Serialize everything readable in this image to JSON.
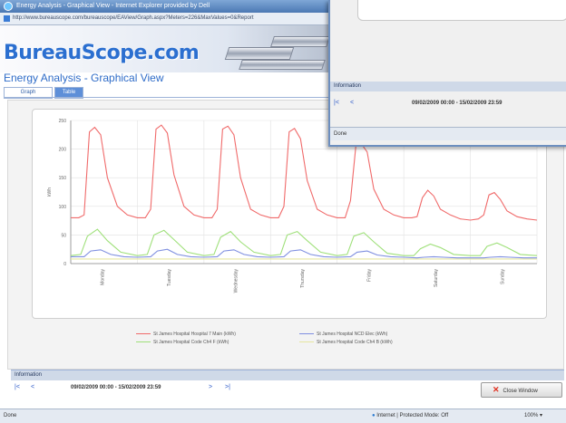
{
  "window": {
    "title": "Energy Analysis - Graphical View - Internet Explorer provided by Dell",
    "url": "http://www.bureauscope.com/bureauscope/EAView/Graph.aspx?Meters=226&MaxValues=0&Report"
  },
  "brand": {
    "logo": "BureauScope.com"
  },
  "page": {
    "title": "Energy Analysis - Graphical View",
    "tabs": [
      {
        "label": "Graph"
      },
      {
        "label": "Table"
      }
    ]
  },
  "chart_data": {
    "type": "line",
    "ylabel": "kWh",
    "ylim": [
      0,
      250
    ],
    "yticks": [
      0,
      50,
      100,
      150,
      200,
      250
    ],
    "x_range": [
      0,
      7
    ],
    "categories": [
      "Monday",
      "Tuesday",
      "Wednesday",
      "Thursday",
      "Friday",
      "Saturday",
      "Sunday"
    ],
    "series": [
      {
        "name": "St James Hospital Hospital 7 Main (kWh)",
        "color": "#f06a6a",
        "x": [
          0,
          0.12,
          0.2,
          0.28,
          0.36,
          0.45,
          0.55,
          0.7,
          0.85,
          1.0,
          1.12,
          1.2,
          1.28,
          1.36,
          1.45,
          1.55,
          1.7,
          1.85,
          2.0,
          2.12,
          2.2,
          2.28,
          2.36,
          2.45,
          2.55,
          2.7,
          2.85,
          3.0,
          3.12,
          3.2,
          3.28,
          3.36,
          3.45,
          3.55,
          3.7,
          3.85,
          4.0,
          4.12,
          4.2,
          4.28,
          4.36,
          4.45,
          4.55,
          4.7,
          4.85,
          5.0,
          5.12,
          5.2,
          5.28,
          5.36,
          5.45,
          5.55,
          5.7,
          5.85,
          6.0,
          6.12,
          6.2,
          6.28,
          6.36,
          6.45,
          6.55,
          6.7,
          6.85,
          7.0
        ],
        "values": [
          80,
          80,
          85,
          230,
          238,
          225,
          150,
          100,
          85,
          80,
          80,
          95,
          235,
          242,
          228,
          155,
          100,
          85,
          80,
          80,
          95,
          235,
          240,
          225,
          150,
          95,
          85,
          80,
          80,
          100,
          230,
          236,
          218,
          145,
          95,
          85,
          80,
          80,
          110,
          205,
          210,
          195,
          130,
          95,
          85,
          80,
          80,
          82,
          115,
          128,
          118,
          95,
          85,
          78,
          76,
          78,
          85,
          120,
          124,
          112,
          92,
          82,
          78,
          76
        ]
      },
      {
        "name": "St James Hospital NCD Elec (kWh)",
        "color": "#7f8fe0",
        "x": [
          0,
          0.2,
          0.3,
          0.45,
          0.6,
          0.8,
          1.0,
          1.2,
          1.3,
          1.45,
          1.6,
          1.8,
          2.0,
          2.2,
          2.3,
          2.45,
          2.6,
          2.8,
          3.0,
          3.2,
          3.3,
          3.45,
          3.6,
          3.8,
          4.0,
          4.2,
          4.3,
          4.45,
          4.6,
          4.8,
          5.0,
          5.2,
          5.3,
          5.45,
          5.6,
          5.8,
          6.0,
          6.2,
          6.3,
          6.45,
          6.6,
          6.8,
          7.0
        ],
        "values": [
          12,
          12,
          22,
          24,
          16,
          12,
          11,
          12,
          22,
          25,
          16,
          12,
          11,
          12,
          22,
          24,
          16,
          12,
          11,
          12,
          22,
          24,
          16,
          12,
          11,
          12,
          20,
          22,
          15,
          12,
          11,
          10,
          11,
          12,
          11,
          10,
          10,
          10,
          11,
          12,
          11,
          10,
          10
        ]
      },
      {
        "name": "St James Hospital Code Ch4 F (kWh)",
        "color": "#9fe07a",
        "x": [
          0,
          0.15,
          0.25,
          0.4,
          0.55,
          0.75,
          1.0,
          1.15,
          1.25,
          1.4,
          1.55,
          1.75,
          2.0,
          2.15,
          2.25,
          2.4,
          2.55,
          2.75,
          3.0,
          3.15,
          3.25,
          3.4,
          3.55,
          3.75,
          4.0,
          4.15,
          4.25,
          4.4,
          4.55,
          4.75,
          5.0,
          5.15,
          5.25,
          5.4,
          5.55,
          5.75,
          6.0,
          6.15,
          6.25,
          6.4,
          6.55,
          6.75,
          7.0
        ],
        "values": [
          14,
          16,
          48,
          60,
          40,
          20,
          14,
          16,
          50,
          58,
          42,
          20,
          14,
          16,
          46,
          56,
          38,
          20,
          14,
          16,
          50,
          56,
          40,
          20,
          14,
          16,
          48,
          54,
          38,
          18,
          14,
          14,
          26,
          34,
          28,
          16,
          14,
          14,
          30,
          36,
          28,
          16,
          14
        ]
      },
      {
        "name": "St James Hospital Code Ch4 B (kWh)",
        "color": "#e6e6a0",
        "x": [
          0,
          1,
          2,
          3,
          4,
          5,
          6,
          7
        ],
        "values": [
          8,
          8,
          8,
          8,
          8,
          8,
          8,
          8
        ]
      }
    ]
  },
  "info": {
    "label": "Information",
    "range": "09/02/2009 00:00 - 15/02/2009 23:59",
    "first": "|<",
    "prev": "<",
    "next": ">",
    "last": ">|",
    "close_label": "Close Window"
  },
  "popup": {
    "info_label": "Information",
    "range": "09/02/2009 00:00 - 15/02/2009 23:59",
    "first": "|<",
    "prev": "<",
    "status": "Done"
  },
  "status": {
    "left": "Done",
    "zone": "Internet | Protected Mode: Off",
    "zoom": "100%"
  }
}
